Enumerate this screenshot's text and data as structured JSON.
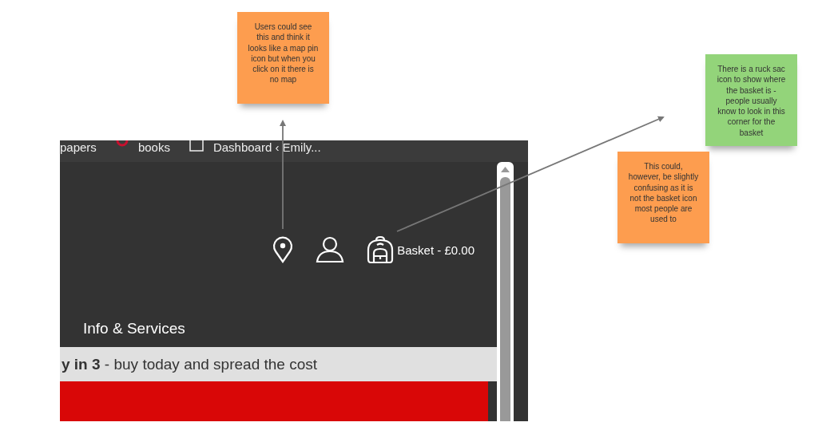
{
  "screenshot": {
    "bookmarks": [
      {
        "kind": "text",
        "label": "papers"
      },
      {
        "kind": "ring",
        "label": "books"
      },
      {
        "kind": "page",
        "label": "Dashboard ‹ Emily..."
      }
    ],
    "header_actions": [
      {
        "kind": "pin"
      },
      {
        "kind": "user"
      },
      {
        "kind": "bag",
        "label": "Basket - £0.00"
      }
    ],
    "nav_item": "Info & Services",
    "banner": "**y in 3** - buy today and spread the cost"
  },
  "notes": [
    {
      "text": "Users could see this and think it looks like a map pin icon but when you click on it there is no map",
      "color": "#fd9d4f"
    },
    {
      "text": "There is a ruck sac icon to show where the basket is - people usually know to look in this corner for the basket",
      "color": "#93d47a"
    },
    {
      "text": "This could, however, be slightly confusing as it is not the basket icon most people are used to",
      "color": "#fd9d4f"
    }
  ]
}
